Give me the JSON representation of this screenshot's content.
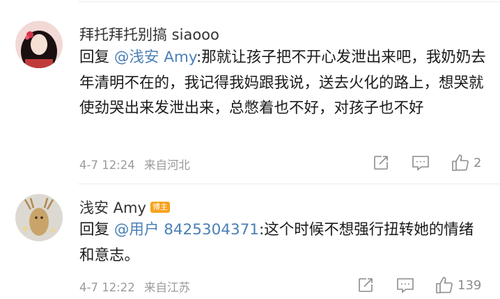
{
  "comments": [
    {
      "username": "拜托拜托别搞 siaooo",
      "badge": "",
      "reply_prefix": "回复",
      "mention": "@浅安 Amy",
      "text": ":那就让孩子把不开心发泄出来吧，我奶奶去年清明不在的，我记得我妈跟我说，送去火化的路上，想哭就使劲哭出来发泄出来，总憋着也不好，对孩子也不好",
      "time": "4-7 12:24",
      "location": "来自河北",
      "likes": "2",
      "icons": [
        "share-icon",
        "comment-icon",
        "like-icon"
      ]
    },
    {
      "username": "浅安 Amy",
      "badge": "博主",
      "reply_prefix": "回复",
      "mention": "@用户 8425304371",
      "text": ":这个时候不想强行扭转她的情绪和意志。",
      "time": "4-7 12:22",
      "location": "来自江苏",
      "likes": "139",
      "icons": [
        "share-icon",
        "comment-icon",
        "like-icon"
      ]
    }
  ],
  "colors": {
    "mention": "#4a7fb5",
    "meta": "#9a9a9a",
    "badge": "#f7a21b"
  }
}
